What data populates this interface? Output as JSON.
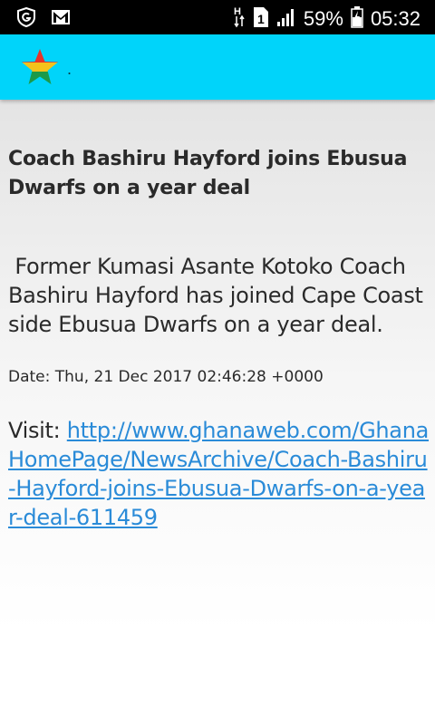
{
  "status_bar": {
    "battery": "59%",
    "time": "05:32",
    "icons": [
      "shield-icon",
      "gmail-icon",
      "data-arrows-icon",
      "sim-1-icon",
      "signal-icon",
      "battery-icon"
    ],
    "sim_slot": "1",
    "network_type": "H"
  },
  "app_bar": {
    "title": ".",
    "logo": "ghana-star-logo",
    "colors": {
      "background": "#00d4fa"
    }
  },
  "article": {
    "headline": "Coach Bashiru Hayford joins Ebusua Dwarfs on a year deal",
    "summary": " Former Kumasi Asante Kotoko Coach Bashiru Hayford has joined Cape Coast side Ebusua Dwarfs on a year deal.",
    "date": "Date: Thu, 21 Dec 2017 02:46:28 +0000",
    "visit_label": "Visit: ",
    "link": "http://www.ghanaweb.com/GhanaHomePage/NewsArchive/Coach-Bashiru-Hayford-joins-Ebusua-Dwarfs-on-a-year-deal-611459",
    "link_color": "#2a8bd8"
  }
}
